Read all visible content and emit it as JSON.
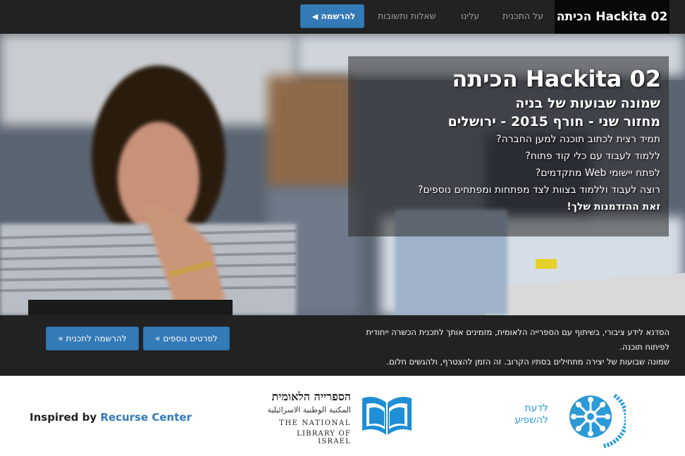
{
  "navbar": {
    "brand": "Hackita 02 הכיתה",
    "links": [
      "על התכנית",
      "עלינו",
      "שאלות ותשובות"
    ],
    "register_label": "להרשמה",
    "accent_color": "#337ab7"
  },
  "hero": {
    "title": "Hackita 02 הכיתה",
    "subtitle_1": "שמונה שבועות של בניה",
    "subtitle_2": "מחזור שני - חורף 2015 - ירושלים",
    "lines": [
      "תמיד רצית לכתוב תוכנה למען החברה?",
      "ללמוד לעבוד עם כלי קוד פתוח?",
      "לפתח יישומי Web מתקדמים?",
      "רוצה לעבוד וללמוד בצוות לצד מפתחות ומפתחים נוספים?"
    ],
    "closing": "זאת ההזדמנות שלך!"
  },
  "info": {
    "text_1": "הסדנא לידע ציבורי, בשיתוף עם הספרייה הלאומית, מזמינים אותך לתכנית הכשרה ייחודית לפיתוח תוכנה.",
    "text_2": "שמונה שבועות של יצירה מתחילים בסתיו הקרוב. זה הזמן להצטרף, ולהגשים חלום.",
    "more_button": "לפרטים נוספים »",
    "register_button": "להרשמה לתכנית »"
  },
  "footer": {
    "inspired_prefix": "Inspired by",
    "inspired_link": "Recurse Center",
    "nli_hebrew": "הספרייה הלאומית",
    "nli_arabic": "المكتبة الوطنية الاسرائيلية",
    "nli_english_1": "THE NATIONAL",
    "nli_english_2": "LIBRARY OF ISRAEL",
    "sadna_line_1": "לדעת",
    "sadna_line_2": "להשפיע",
    "sadna_logo_text": "הסדנא לידע ציבורי",
    "sadna_color": "#2b9ad6"
  }
}
